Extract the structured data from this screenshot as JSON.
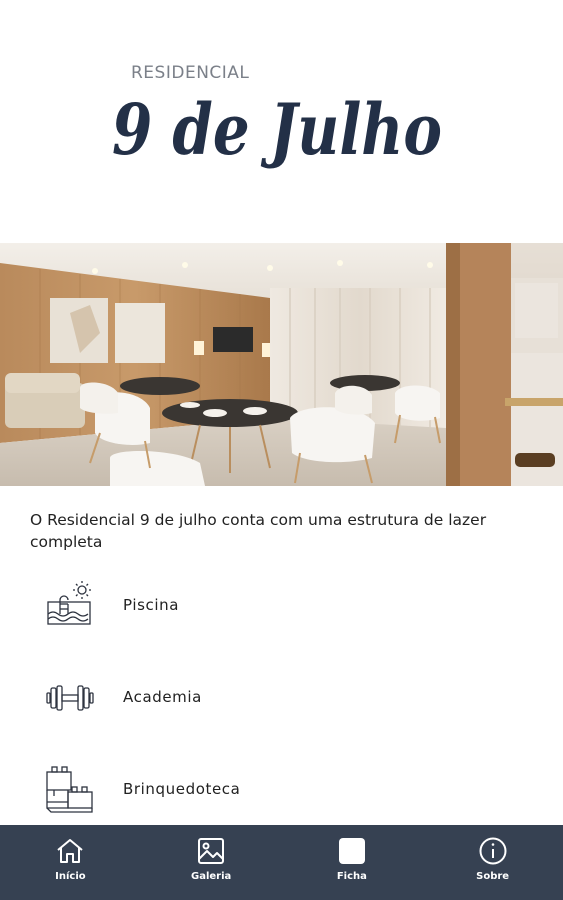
{
  "logo": {
    "subtitle": "RESIDENCIAL",
    "title": "9 de Julho"
  },
  "hero": {
    "icon": "dining-room-photo"
  },
  "intro": {
    "text": "O Residencial 9 de julho conta com uma estrutura de lazer completa"
  },
  "amenities": [
    {
      "label": "Piscina",
      "icon": "pool-icon"
    },
    {
      "label": "Academia",
      "icon": "dumbbell-icon"
    },
    {
      "label": "Brinquedoteca",
      "icon": "toy-blocks-icon"
    }
  ],
  "nav": {
    "items": [
      {
        "label": "Início",
        "icon": "home-icon"
      },
      {
        "label": "Galeria",
        "icon": "gallery-icon"
      },
      {
        "label": "Ficha",
        "icon": "card-icon"
      },
      {
        "label": "Sobre",
        "icon": "info-icon"
      }
    ]
  },
  "colors": {
    "brand": "#233047",
    "nav_bg": "#364152",
    "text": "#222222",
    "subtitle": "#7b8089"
  }
}
